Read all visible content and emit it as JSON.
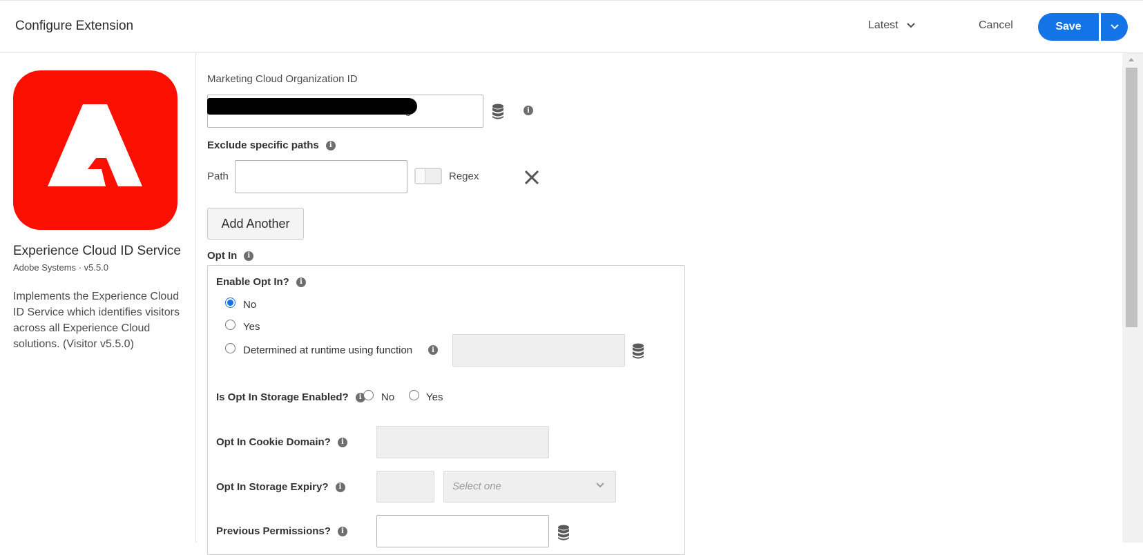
{
  "header": {
    "title": "Configure Extension",
    "version_selector": "Latest",
    "cancel_label": "Cancel",
    "save_label": "Save"
  },
  "extension": {
    "name": "Experience Cloud ID Service",
    "publisher_version": "Adobe Systems · v5.5.0",
    "description": "Implements the Experience Cloud ID Service which identifies visitors across all Experience Cloud solutions. (Visitor v5.5.0)",
    "logo_color": "#fa0f00"
  },
  "form": {
    "org_id_label": "Marketing Cloud Organization ID",
    "org_id_value_tail": "g",
    "exclude_paths_label": "Exclude specific paths",
    "path_label": "Path",
    "regex_label": "Regex",
    "add_another_label": "Add Another",
    "opt_in_section_label": "Opt In",
    "enable_opt_in_label": "Enable Opt In?",
    "enable_opt_in_options": [
      "No",
      "Yes",
      "Determined at runtime using function"
    ],
    "enable_opt_in_selected": "No",
    "storage_enabled_label": "Is Opt In Storage Enabled?",
    "storage_enabled_options": [
      "No",
      "Yes"
    ],
    "cookie_domain_label": "Opt In Cookie Domain?",
    "storage_expiry_label": "Opt In Storage Expiry?",
    "storage_expiry_unit_placeholder": "Select one",
    "previous_permissions_label": "Previous Permissions?"
  },
  "colors": {
    "accent": "#1473e6"
  }
}
